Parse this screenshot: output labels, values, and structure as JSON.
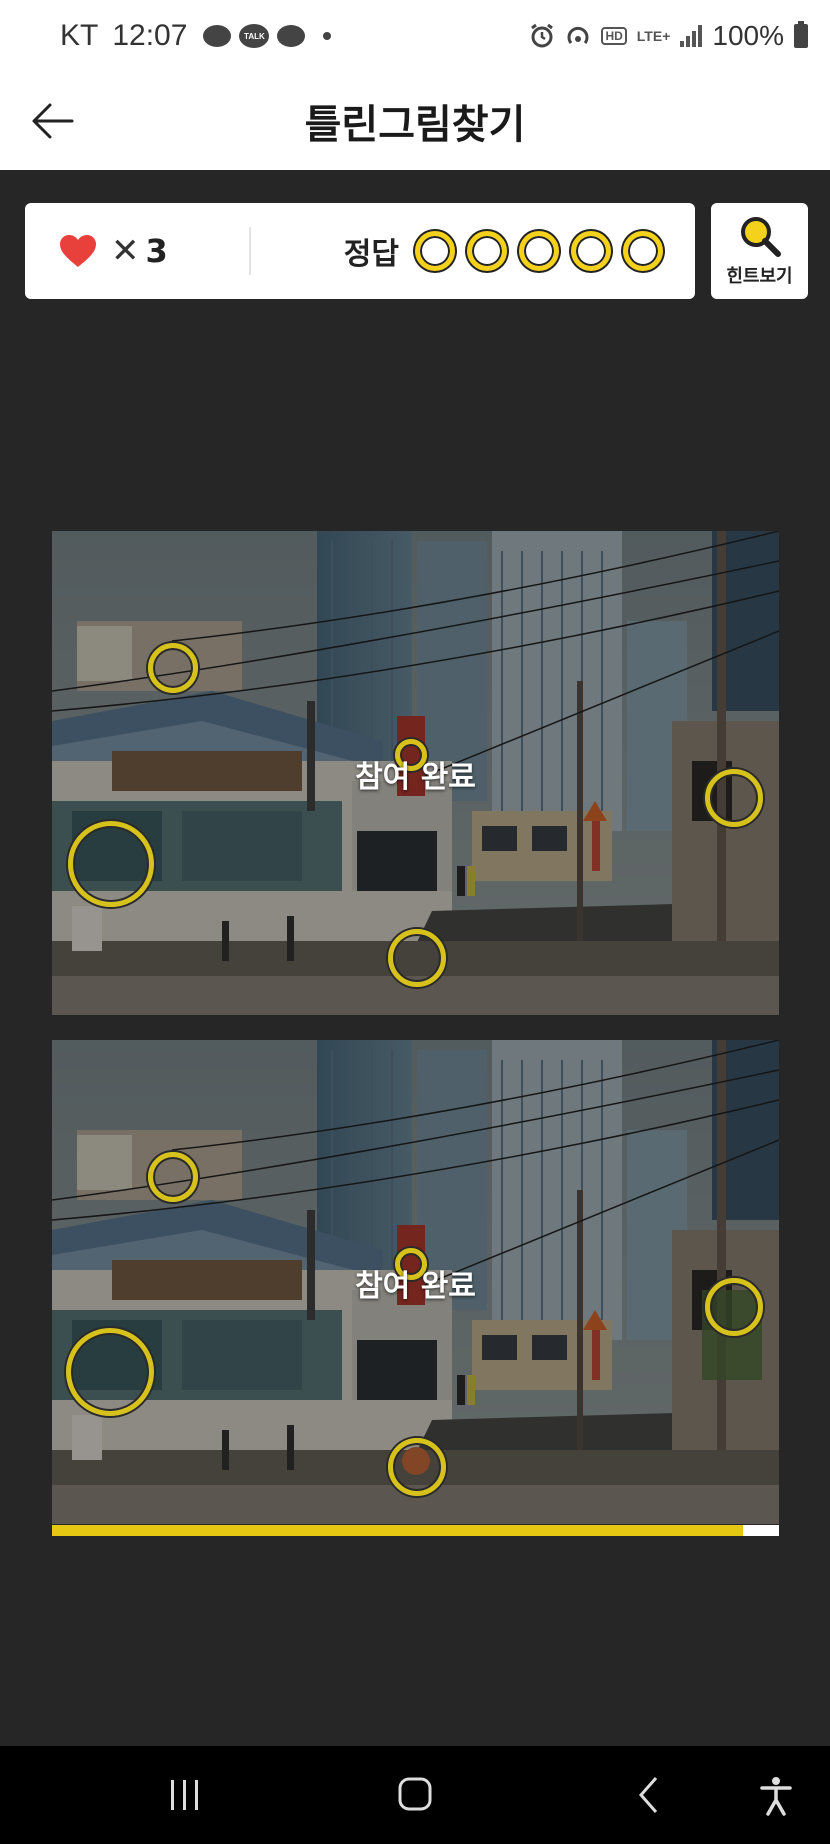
{
  "status_bar": {
    "carrier": "KT",
    "time": "12:07",
    "talk_label": "TALK",
    "hd_label": "HD",
    "network": "LTE+",
    "battery": "100%"
  },
  "header": {
    "title": "틀린그림찾기"
  },
  "score": {
    "lives_count": "3",
    "answer_label": "정답",
    "answer_slots_total": 5
  },
  "hint": {
    "label": "힌트보기"
  },
  "pictures": {
    "top_overlay": "참여 완료",
    "bottom_overlay": "참여 완료"
  },
  "progress": {
    "fraction": 0.95
  },
  "colors": {
    "accent_yellow": "#f4d21c",
    "heart_red": "#e8403a",
    "background": "#262626"
  },
  "icons": {
    "back": "arrow-left-icon",
    "heart": "heart-icon",
    "hint": "magnifier-icon",
    "recent": "recent-apps-icon",
    "home": "home-icon",
    "nav_back": "chevron-left-icon",
    "accessibility": "accessibility-icon"
  }
}
